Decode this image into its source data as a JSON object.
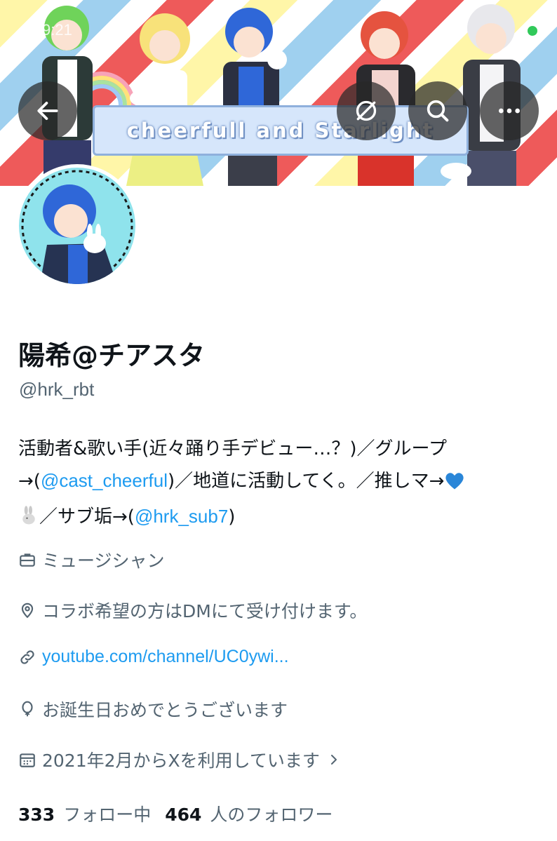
{
  "status_bar": {
    "time": "9:21"
  },
  "banner": {
    "title_text": "cheerfull and Starlight"
  },
  "header_buttons": {
    "back_icon": "arrow-left-icon",
    "translate_icon": "translate-off-icon",
    "search_icon": "search-icon",
    "more_icon": "more-horizontal-icon"
  },
  "profile": {
    "display_name": "陽希@チアスタ",
    "handle": "@hrk_rbt",
    "bio": {
      "part1": "活動者&歌い手(近々踊り手デビュー…？)／グループ→(",
      "mention1": "@cast_cheerful",
      "part2": ")／地道に活動してく。／推しマ→",
      "emoji1": "blue-heart",
      "emoji2": "rabbit",
      "part3": "／サブ垢→(",
      "mention2": "@hrk_sub7",
      "part4": ")"
    },
    "profession": "ミュージシャン",
    "location": "コラボ希望の方はDMにて受け付けます。",
    "link": "youtube.com/channel/UC0ywi...",
    "birthday": "お誕生日おめでとうございます",
    "joined": "2021年2月からXを利用しています"
  },
  "stats": {
    "following_count": "333",
    "following_label": "フォロー中",
    "followers_count": "464",
    "followers_label": "人のフォロワー"
  },
  "colors": {
    "link_blue": "#1d9bf0",
    "secondary_text": "#536471",
    "primary_text": "#0f1419",
    "avatar_bg": "#8fe3ec"
  }
}
